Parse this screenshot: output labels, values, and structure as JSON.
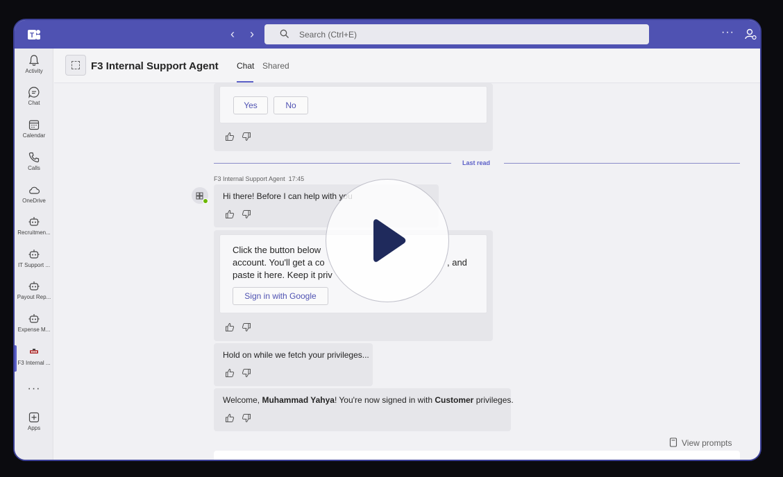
{
  "titlebar": {
    "back_icon": "chevron-left-icon",
    "forward_icon": "chevron-right-icon",
    "search_placeholder": "Search (Ctrl+E)",
    "more_label": "···",
    "colors": {
      "titlebar": "#4f52b2",
      "accent": "#5b5fc7"
    }
  },
  "rail": {
    "items": [
      {
        "label": "Activity",
        "icon": "bell-icon"
      },
      {
        "label": "Chat",
        "icon": "chat-icon"
      },
      {
        "label": "Calendar",
        "icon": "calendar-icon"
      },
      {
        "label": "Calls",
        "icon": "phone-icon"
      },
      {
        "label": "OneDrive",
        "icon": "cloud-icon"
      },
      {
        "label": "Recruitmen...",
        "icon": "bot-icon"
      },
      {
        "label": "IT Support ...",
        "icon": "bot-icon"
      },
      {
        "label": "Payout Rep...",
        "icon": "bot-icon"
      },
      {
        "label": "Expense M...",
        "icon": "bot-icon"
      },
      {
        "label": "F3 Internal ...",
        "icon": "agent-logo-icon"
      }
    ],
    "more_label": "···",
    "apps_label": "Apps"
  },
  "header": {
    "title": "F3 Internal Support Agent",
    "tabs": [
      {
        "label": "Chat",
        "active": true
      },
      {
        "label": "Shared",
        "active": false
      }
    ]
  },
  "chat": {
    "prev_card": {
      "yes_label": "Yes",
      "no_label": "No"
    },
    "last_read_label": "Last read",
    "sender": "F3 Internal Support Agent",
    "time": "17:45",
    "messages": {
      "greeting": "Hi there! Before I can help with you",
      "signin_card_lines": [
        "Click the button below",
        "account. You'll get a co",
        "paste it here. Keep it priv"
      ],
      "signin_card_tail": ", and",
      "signin_button": "Sign in with Google",
      "hold_on": "Hold on while we fetch your privileges...",
      "welcome_prefix": "Welcome, ",
      "welcome_name": "Muhammad Yahya",
      "welcome_mid": "! You're now signed in with ",
      "welcome_role": "Customer",
      "welcome_suffix": " privileges."
    },
    "view_prompts_label": "View prompts"
  },
  "overlay": {
    "icon": "play-icon",
    "color": "#1f2a5c"
  }
}
